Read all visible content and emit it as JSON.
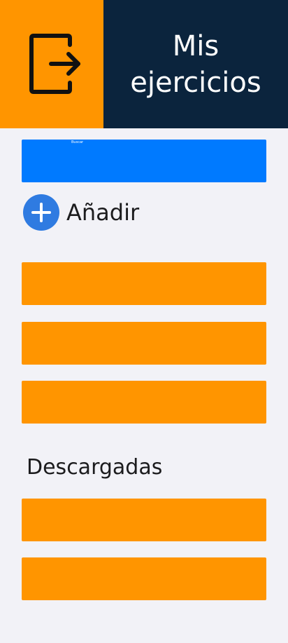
{
  "header": {
    "title": "Mis ejercicios",
    "exit_icon": "logout-icon"
  },
  "search": {
    "placeholder": "Buscar"
  },
  "add": {
    "label": "Añadir",
    "icon": "plus-circle-icon"
  },
  "exercises": [
    {
      "label": ""
    },
    {
      "label": ""
    },
    {
      "label": ""
    }
  ],
  "downloads": {
    "title": "Descargadas",
    "items": [
      {
        "label": ""
      },
      {
        "label": ""
      }
    ]
  },
  "colors": {
    "accent_orange": "#ff9500",
    "header_navy": "#0b243d",
    "search_blue": "#007aff",
    "add_blue": "#2f7be1",
    "background": "#f2f2f7"
  }
}
